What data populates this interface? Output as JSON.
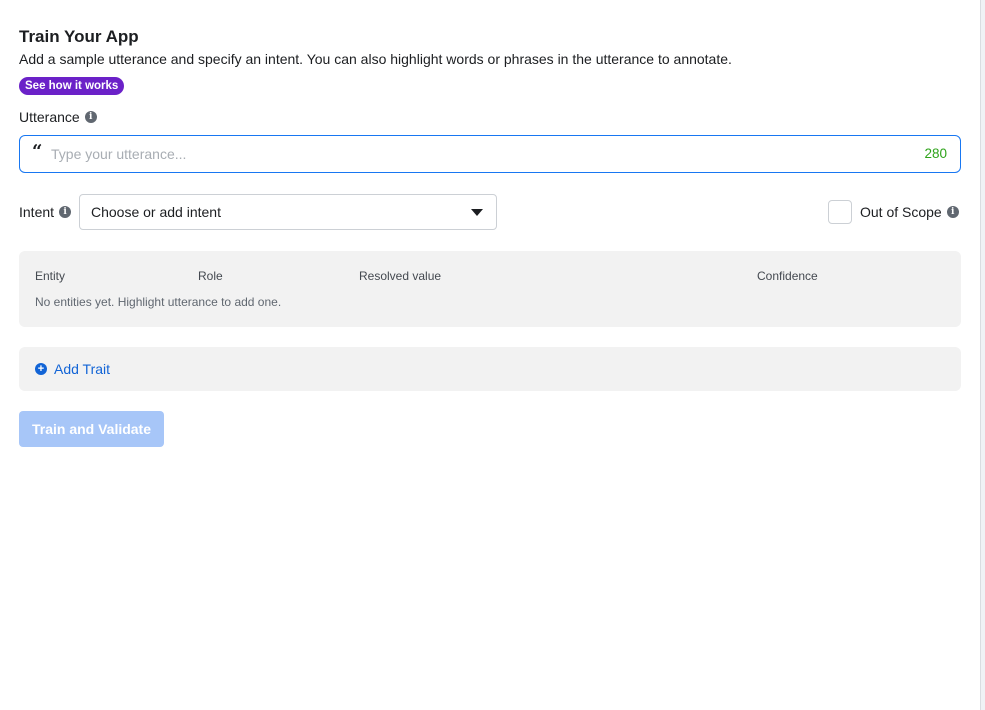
{
  "header": {
    "title": "Train Your App",
    "subtitle": "Add a sample utterance and specify an intent. You can also highlight words or phrases in the utterance to annotate.",
    "see_how_label": "See how it works"
  },
  "utterance": {
    "label": "Utterance",
    "placeholder": "Type your utterance...",
    "value": "",
    "char_count": "280"
  },
  "intent": {
    "label": "Intent",
    "selected": "Choose or add intent"
  },
  "out_of_scope": {
    "label": "Out of Scope",
    "checked": false
  },
  "entities_table": {
    "columns": [
      "Entity",
      "Role",
      "Resolved value",
      "Confidence"
    ],
    "empty_message": "No entities yet. Highlight utterance to add one."
  },
  "traits": {
    "add_label": "Add Trait"
  },
  "actions": {
    "train_label": "Train and Validate"
  },
  "colors": {
    "accent": "#1877f2",
    "badge": "#6b21c8",
    "counter": "#2ea31a",
    "link": "#1264d6",
    "disabled_button": "#a7c6f8"
  },
  "icons": {
    "info": "info-icon",
    "quote": "quote-icon",
    "dropdown": "caret-down-icon",
    "add": "plus-circle-icon"
  }
}
